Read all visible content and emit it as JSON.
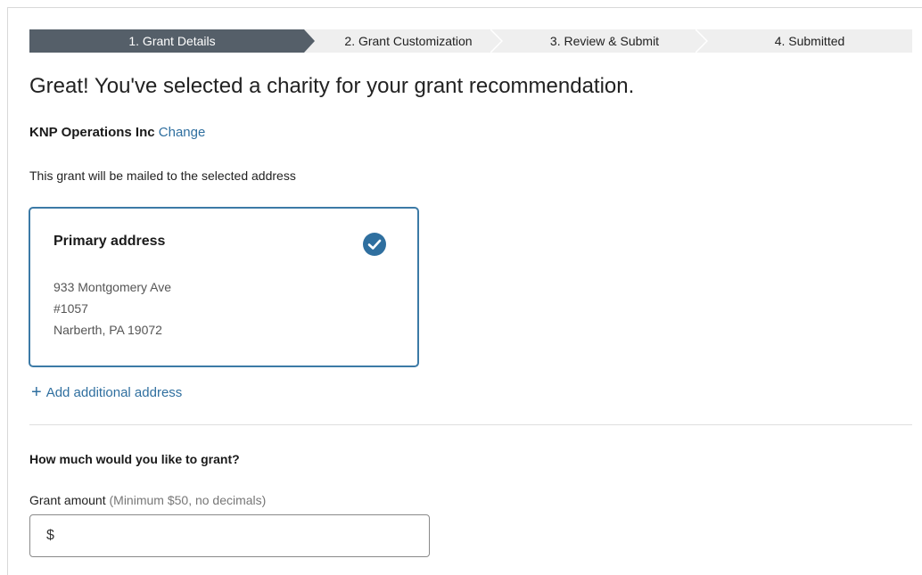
{
  "stepper": {
    "steps": [
      {
        "label": "1. Grant Details",
        "active": true
      },
      {
        "label": "2. Grant Customization",
        "active": false
      },
      {
        "label": "3. Review & Submit",
        "active": false
      },
      {
        "label": "4. Submitted",
        "active": false
      }
    ]
  },
  "headline": "Great! You've selected a charity for your grant recommendation.",
  "charity": {
    "name": "KNP Operations Inc",
    "change_label": "Change"
  },
  "mail_note": "This grant will be mailed to the selected address",
  "address_card": {
    "title": "Primary address",
    "selected": true,
    "lines": [
      "933 Montgomery Ave",
      "#1057",
      "Narberth, PA 19072"
    ]
  },
  "add_address_label": "Add additional address",
  "grant": {
    "question": "How much would you like to grant?",
    "amount_label": "Grant amount",
    "amount_hint": "(Minimum $50, no decimals)",
    "currency_symbol": "$",
    "amount_value": ""
  },
  "colors": {
    "active_step": "#555f69",
    "step_bg": "#efefef",
    "link": "#2f6f9f",
    "card_border": "#3c7aa6",
    "check_fill": "#2f6f9f"
  },
  "icons": {
    "check": "check-circle-icon",
    "plus": "plus-icon"
  }
}
